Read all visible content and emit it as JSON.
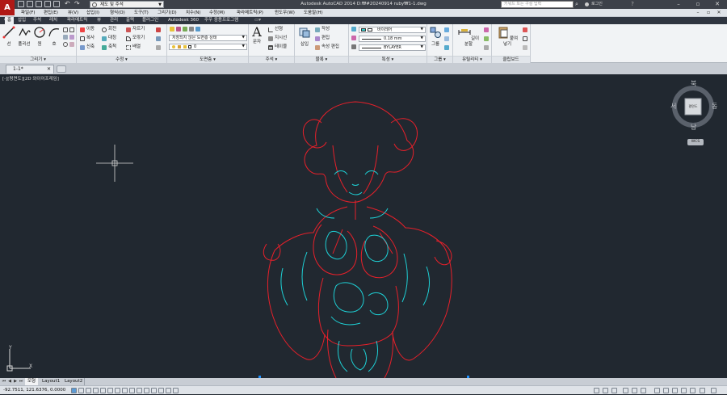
{
  "app": {
    "logo_letter": "A",
    "window_title": "Autodesk AutoCAD 2014    D:₩#20240914 ruby₩1-1.dwg"
  },
  "workspace": {
    "value": "제도 및 주석"
  },
  "search": {
    "placeholder": "키워드 또는 구절 입력",
    "login_label": "로그인"
  },
  "menus": [
    "파일(F)",
    "편집(E)",
    "뷰(V)",
    "삽입(I)",
    "형식(O)",
    "도구(T)",
    "그리기(D)",
    "치수(N)",
    "수정(M)",
    "파라메트릭(P)",
    "윈도우(W)",
    "도움말(H)"
  ],
  "ribbon_tabs": [
    "홈",
    "삽입",
    "주석",
    "레치",
    "파라메트릭",
    "뷰",
    "관리",
    "출력",
    "플러그인",
    "Autodesk 360",
    "주우 응용프로그램"
  ],
  "panels": {
    "draw": {
      "title": "그리기",
      "tools": [
        "선",
        "폴리선",
        "원",
        "호"
      ]
    },
    "modify": {
      "title": "수정",
      "rows": [
        [
          "이동",
          "회전",
          "자르기"
        ],
        [
          "복사",
          "대칭",
          "모깎기"
        ],
        [
          "신축",
          "축척",
          "배열"
        ]
      ]
    },
    "layers": {
      "title": "도면층",
      "layer_state": "저장되지 않은 도면층 상태",
      "current_layer": "0"
    },
    "annotation": {
      "title": "주석",
      "text_tool": "문자",
      "items": [
        "선형",
        "지시선",
        "테이블"
      ]
    },
    "block": {
      "title": "블록",
      "insert": "삽입",
      "items": [
        "작성",
        "편집",
        "속성 편집"
      ]
    },
    "properties": {
      "title": "특성",
      "color": "ByLayer",
      "color_label": "바이레어",
      "lineweight": "0.18 mm",
      "linetype": "BYLAYER"
    },
    "groups": {
      "title": "그룹",
      "group": "그룹"
    },
    "utilities": {
      "title": "유틸리티",
      "measure": "길이 분할"
    },
    "clipboard": {
      "title": "클립보드",
      "paste": "붙여넣기"
    }
  },
  "doc_tab": {
    "label": "1-1*"
  },
  "viewport": {
    "label": "[-][평면도][2D 와이어프레임]",
    "viewcube": {
      "north": "북",
      "south": "남",
      "east": "동",
      "west": "서",
      "face": "평면도",
      "wcs": "WCS"
    },
    "ucs": {
      "x": "X",
      "y": "Y"
    },
    "colors": {
      "red": "#e8202a",
      "cyan": "#1ed1d6",
      "background": "#212830"
    }
  },
  "layout_tabs": [
    "모형",
    "Layout1",
    "Layout2"
  ],
  "status": {
    "coordinates": "-92.7511, 121.6376, 0.0000"
  }
}
